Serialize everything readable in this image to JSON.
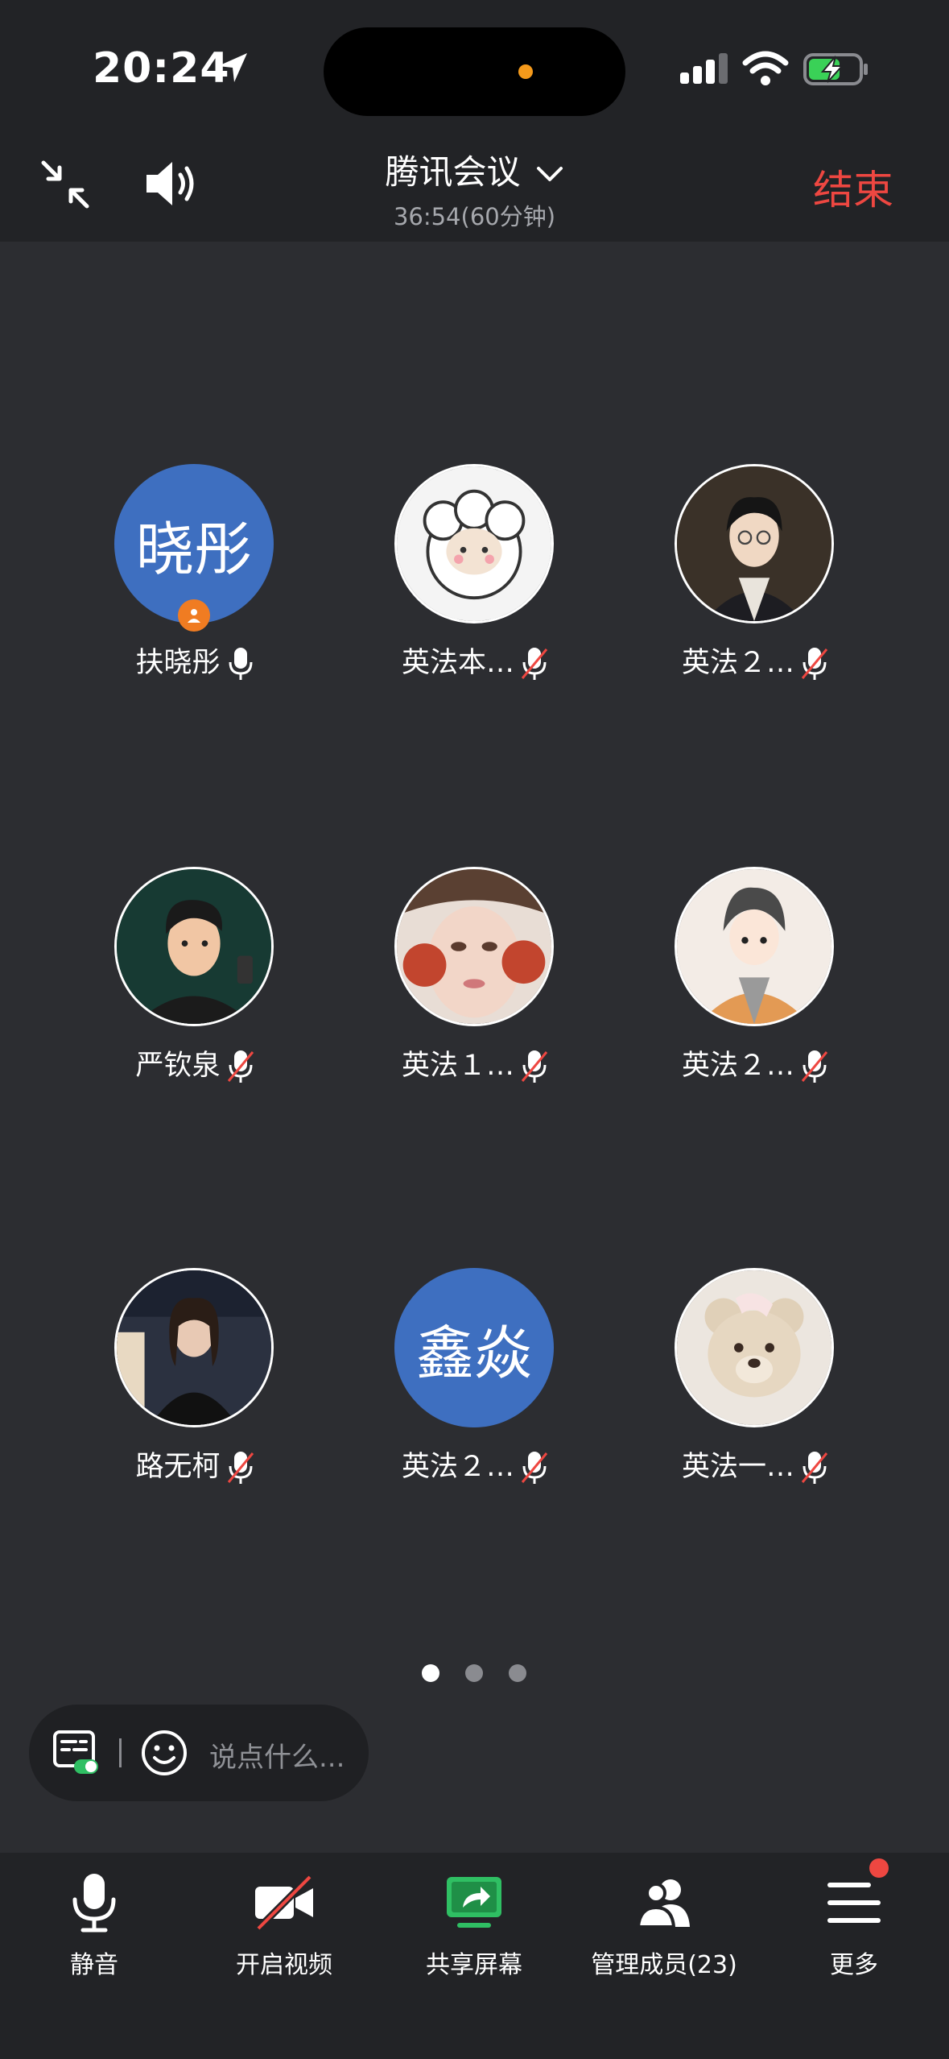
{
  "status_bar": {
    "time": "20:24"
  },
  "header": {
    "title": "腾讯会议",
    "timer": "36:54(60分钟)",
    "end_label": "结束"
  },
  "participants": [
    {
      "name": "扶晓彤",
      "avatar_text": "晓彤",
      "mic": "on",
      "host": true
    },
    {
      "name": "英法本…",
      "avatar_icon": "sheep-avatar",
      "mic": "muted"
    },
    {
      "name": "英法２…",
      "avatar_icon": "anime-boy-avatar",
      "mic": "muted"
    },
    {
      "name": "严钦泉",
      "avatar_icon": "cartoon-man-avatar",
      "mic": "muted"
    },
    {
      "name": "英法１…",
      "avatar_icon": "photo-girl-avatar",
      "mic": "muted"
    },
    {
      "name": "英法２…",
      "avatar_icon": "cartoon-girl-avatar",
      "mic": "muted"
    },
    {
      "name": "路无柯",
      "avatar_icon": "photo-woman-avatar",
      "mic": "muted"
    },
    {
      "name": "英法２…",
      "avatar_text": "鑫焱",
      "mic": "muted"
    },
    {
      "name": "英法一…",
      "avatar_icon": "teddy-bear-avatar",
      "mic": "muted"
    }
  ],
  "pager": {
    "pages": 3,
    "current": 1
  },
  "chat": {
    "placeholder": "说点什么..."
  },
  "toolbar": {
    "mute_label": "静音",
    "video_label": "开启视频",
    "share_label": "共享屏幕",
    "members_label": "管理成员(23)",
    "more_label": "更多"
  },
  "colors": {
    "accent_red": "#ee4741",
    "share_green": "#2fbf63",
    "avatar_blue": "#3e6fc0",
    "host_badge": "#f07c22"
  }
}
